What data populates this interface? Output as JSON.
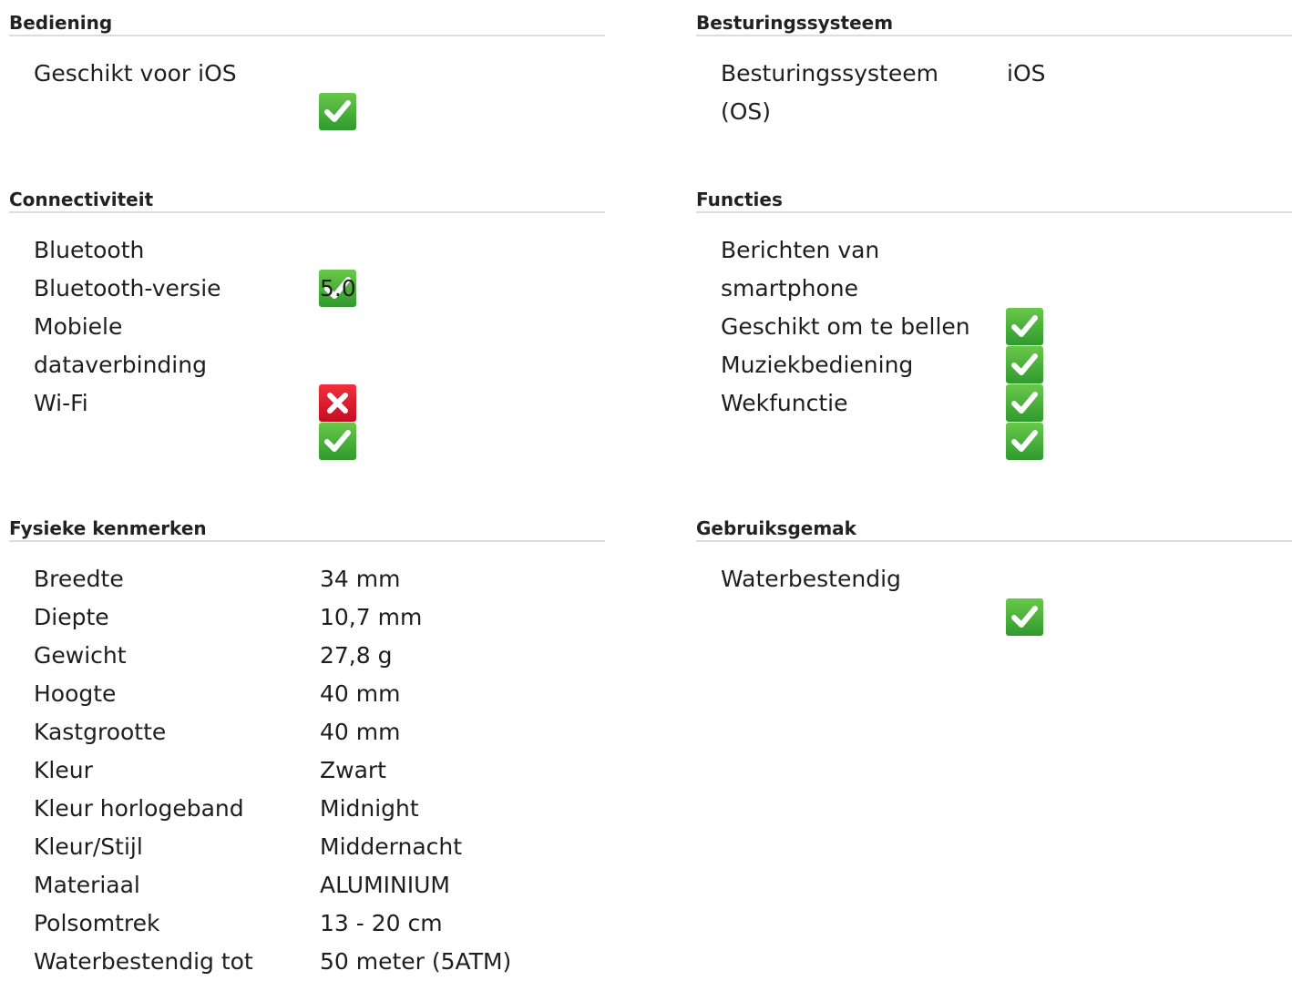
{
  "icons": {
    "yes": "checkmark-icon",
    "no": "cross-icon"
  },
  "colors": {
    "yes": "#3aa935",
    "no": "#e2142c",
    "divider": "#dcdcdc"
  },
  "sections": {
    "bediening": {
      "title": "Bediening",
      "rows": [
        {
          "label": "Geschikt voor iOS",
          "check": true
        }
      ]
    },
    "besturingssysteem": {
      "title": "Besturingssysteem",
      "rows": [
        {
          "label": "Besturingssysteem (OS)",
          "value": "iOS"
        }
      ]
    },
    "connectiviteit": {
      "title": "Connectiviteit",
      "rows": [
        {
          "label": "Bluetooth",
          "check": true
        },
        {
          "label": "Bluetooth-versie",
          "value": "5.0"
        },
        {
          "label": "Mobiele dataverbinding",
          "check": false
        },
        {
          "label": "Wi-Fi",
          "check": true
        }
      ]
    },
    "functies": {
      "title": "Functies",
      "rows": [
        {
          "label": "Berichten van smartphone",
          "check": true
        },
        {
          "label": "Geschikt om te bellen",
          "check": true
        },
        {
          "label": "Muziekbediening",
          "check": true
        },
        {
          "label": "Wekfunctie",
          "check": true
        }
      ]
    },
    "fysieke": {
      "title": "Fysieke kenmerken",
      "rows": [
        {
          "label": "Breedte",
          "value": "34 mm"
        },
        {
          "label": "Diepte",
          "value": "10,7 mm"
        },
        {
          "label": "Gewicht",
          "value": "27,8 g"
        },
        {
          "label": "Hoogte",
          "value": "40 mm"
        },
        {
          "label": "Kastgrootte",
          "value": "40 mm"
        },
        {
          "label": "Kleur",
          "value": "Zwart"
        },
        {
          "label": "Kleur horlogeband",
          "value": "Midnight"
        },
        {
          "label": "Kleur/Stijl",
          "value": "Middernacht"
        },
        {
          "label": "Materiaal",
          "value": "ALUMINIUM"
        },
        {
          "label": "Polsomtrek",
          "value": "13 - 20 cm"
        },
        {
          "label": "Waterbestendig tot",
          "value": "50 meter (5ATM)"
        }
      ]
    },
    "gebruiksgemak": {
      "title": "Gebruiksgemak",
      "rows": [
        {
          "label": "Waterbestendig",
          "check": true
        }
      ]
    }
  }
}
